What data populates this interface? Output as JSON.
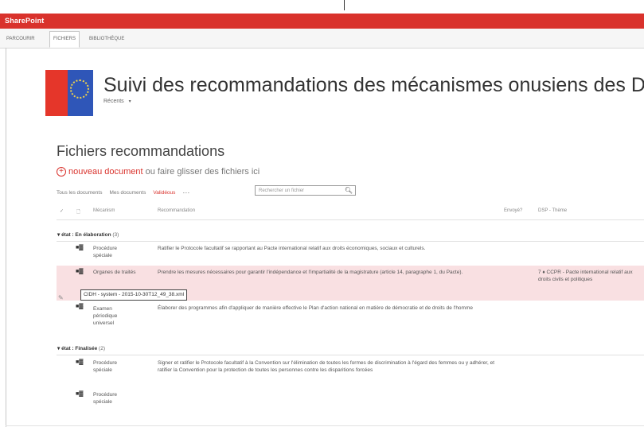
{
  "suite": {
    "brand": "SharePoint"
  },
  "ribbon": {
    "tabs": [
      "Parcourir",
      "Fichiers",
      "Bibliothèque"
    ]
  },
  "site": {
    "title": "Suivi des recommandations des mécanismes onusiens des DH",
    "nav_item": "Récents",
    "nav_caret": "▾"
  },
  "list": {
    "title": "Fichiers recommandations",
    "new_document": "nouveau document",
    "new_document_rest": "ou faire glisser des fichiers ici",
    "views": [
      "Tous les documents",
      "Mes documents",
      "Validéous"
    ],
    "more": "···",
    "search_placeholder": "Rechercher un fichier"
  },
  "columns": {
    "check": "✓",
    "type": "🗋",
    "mecanism": "Mécanism",
    "recommandation": "Recommandation",
    "envoye": "Envoyé?",
    "dsp": "DSP - Thème"
  },
  "groups": [
    {
      "label": "▾ état : En élaboration",
      "count": "(3)"
    },
    {
      "label": "▾ état : Finalisée",
      "count": "(2)"
    }
  ],
  "rows": [
    {
      "mecanism": "Procédure spéciale",
      "recommandation": "Ratifier le Protocole facultatif se rapportant au Pacte international relatif aux droits économiques, sociaux et culturels.",
      "dsp": ""
    },
    {
      "mecanism": "Organes de traités",
      "recommandation": "Prendre les mesures nécessaires pour garantir l'indépendance et l'impartialité de la magistrature (article 14, paragraphe 1, du Pacte).",
      "dsp": "7 ♦ CCPR - Pacte international relatif aux droits civils et politiques"
    },
    {
      "mecanism": "Examen périodique universel",
      "recommandation": "Élaborer des programmes afin d'appliquer de manière effective le Plan d'action national en matière de démocratie et de droits de l'homme",
      "dsp": ""
    },
    {
      "mecanism": "Procédure spéciale",
      "recommandation": "Signer et ratifier le Protocole facultatif à la Convention sur l'élimination de toutes les formes de discrimination à l'égard des femmes ou y adhérer, et ratifier la Convention pour la protection de toutes les personnes contre les disparitions forcées",
      "dsp": ""
    },
    {
      "mecanism": "Procédure spéciale",
      "recommandation": "",
      "dsp": ""
    }
  ],
  "tooltip": "CIDH - system - 2015-10-30T12_49_38.xml",
  "icons": {
    "document": "doc-icon",
    "edit": "pencil-icon",
    "search": "search-icon"
  }
}
